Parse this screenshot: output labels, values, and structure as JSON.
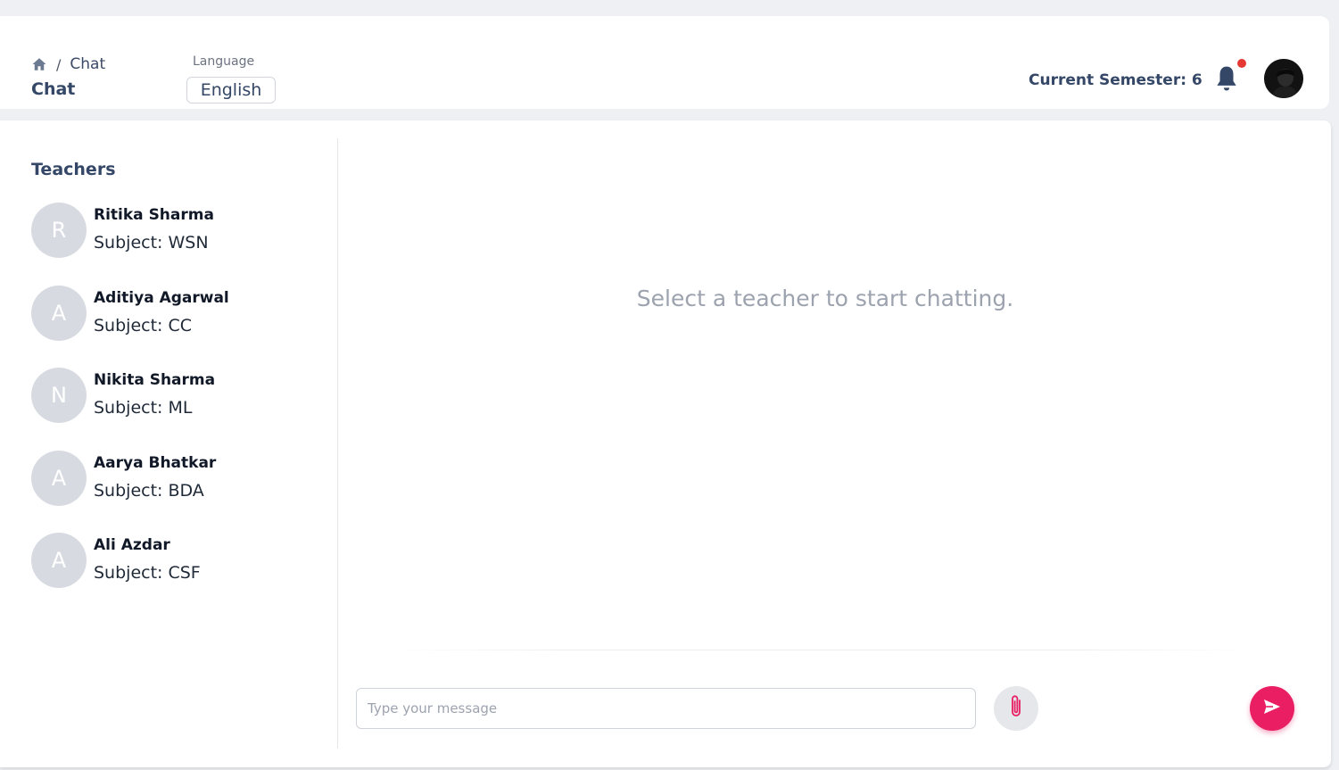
{
  "header": {
    "breadcrumb": {
      "home_icon": "home-icon",
      "separator": "/",
      "current": "Chat"
    },
    "page_title": "Chat",
    "language": {
      "label": "Language",
      "selected": "English"
    },
    "semester": "Current Semester: 6",
    "notification_icon": "bell-icon",
    "notification_dot_color": "#e53935"
  },
  "sidebar": {
    "title": "Teachers",
    "teachers": [
      {
        "initial": "R",
        "name": "Ritika Sharma",
        "subject": "Subject: WSN"
      },
      {
        "initial": "A",
        "name": "Aditiya Agarwal",
        "subject": "Subject: CC"
      },
      {
        "initial": "N",
        "name": "Nikita Sharma",
        "subject": "Subject: ML"
      },
      {
        "initial": "A",
        "name": "Aarya Bhatkar",
        "subject": "Subject: BDA"
      },
      {
        "initial": "A",
        "name": "Ali Azdar",
        "subject": "Subject: CSF"
      }
    ]
  },
  "chat": {
    "empty_message": "Select a teacher to start chatting.",
    "input_placeholder": "Type your message",
    "attach_icon": "paperclip-icon",
    "send_icon": "send-icon",
    "accent_color": "#e91e63"
  }
}
